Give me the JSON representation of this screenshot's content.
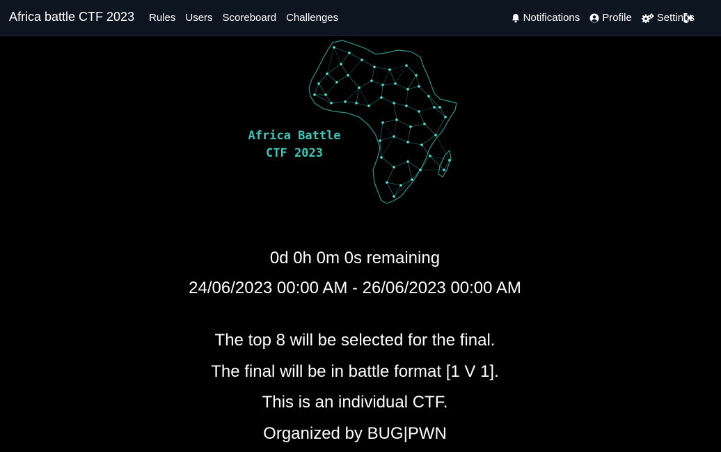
{
  "navbar": {
    "brand": "Africa battle CTF 2023",
    "links": [
      "Rules",
      "Users",
      "Scoreboard",
      "Challenges"
    ],
    "right": {
      "notifications": "Notifications",
      "profile": "Profile",
      "settings": "Settings"
    }
  },
  "hero": {
    "title_line1": "Africa Battle",
    "title_line2": "CTF 2023"
  },
  "countdown": "0d 0h 0m 0s remaining",
  "dates": "24/06/2023 00:00 AM - 26/06/2023 00:00 AM",
  "lines": [
    "The top 8 will be selected for the final.",
    "The final will be in battle format [1 V 1].",
    "This is an individual CTF.",
    "Organized by BUG|PWN"
  ],
  "colors": {
    "accent": "#3cc7b8",
    "navbar_bg": "#0d1520",
    "page_bg": "#000000"
  }
}
